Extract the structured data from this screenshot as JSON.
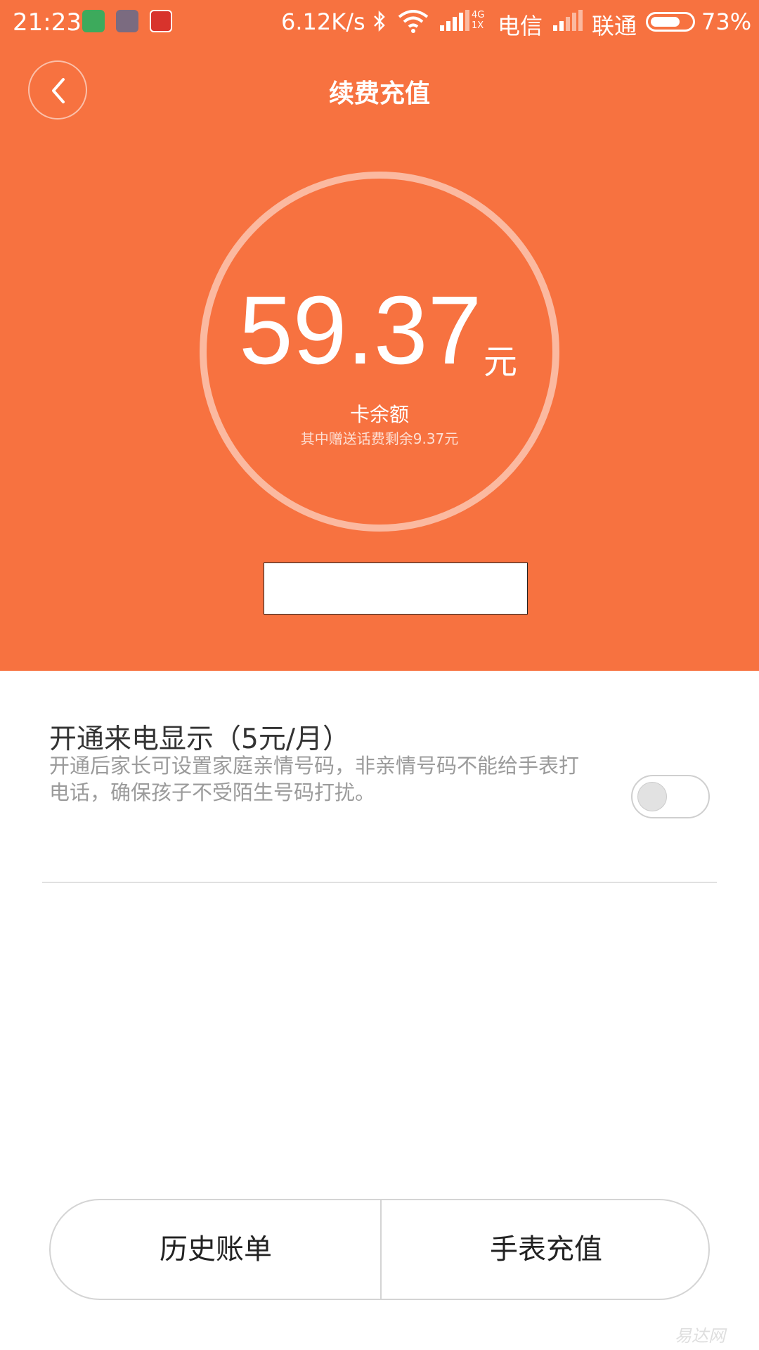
{
  "status_bar": {
    "time": "21:23",
    "net_speed": "6.12K/s",
    "network_type": "4G",
    "network_sub": "1X",
    "carrier_1": "电信",
    "carrier_2": "联通",
    "battery_percent": "73%",
    "battery_level": 0.73,
    "app_icons": [
      "shield-icon",
      "scissors-icon",
      "zhi-app-icon"
    ]
  },
  "header": {
    "title": "续费充值",
    "back_icon": "chevron-left-icon"
  },
  "balance": {
    "amount": "59.37",
    "unit": "元",
    "label": "卡余额",
    "sublabel": "其中赠送话费剩余9.37元"
  },
  "setting": {
    "title": "开通来电显示（5元/月）",
    "description": "开通后家长可设置家庭亲情号码，非亲情号码不能给手表打电话，确保孩子不受陌生号码打扰。",
    "toggle_on": false
  },
  "buttons": {
    "history": "历史账单",
    "recharge": "手表充值"
  },
  "watermark": "易达网",
  "colors": {
    "header_bg": "#F77240",
    "text_dark": "#333333",
    "text_gray": "#9b9b9b"
  }
}
